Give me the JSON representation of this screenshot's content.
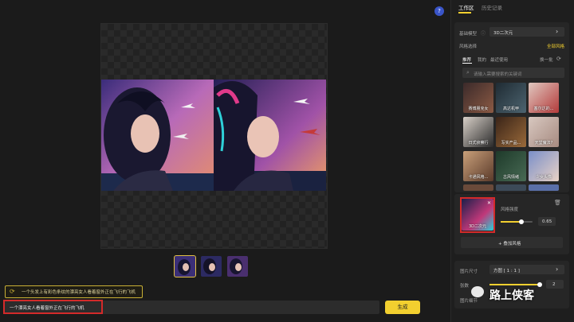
{
  "canvas": {
    "thumbnails": [
      {
        "label": "thumbnail-1",
        "selected": true
      },
      {
        "label": "thumbnail-2",
        "selected": false
      },
      {
        "label": "thumbnail-3",
        "selected": false
      }
    ]
  },
  "help_label": "?",
  "history_chip": "一个头发上有彩色条纹的漂亮女人看着窗外正在飞行的飞机",
  "prompt": {
    "value": "一个漂亮女人看着窗外正在飞行的飞机"
  },
  "generate_label": "生成",
  "panel": {
    "tabs": [
      "工作区",
      "历史记录"
    ],
    "base_model_label": "基础模型",
    "base_model_value": "3D二次元",
    "style_select_label": "风格选择",
    "all_styles": "全部风格",
    "style_tabs": [
      "推荐",
      "我的",
      "最近使用"
    ],
    "refresh_label": "换一批",
    "search_placeholder": "请输入需要搜索的关键词",
    "styles": [
      "赛博朋克女",
      "高达机甲",
      "塞尔达的...",
      "日式侦察行",
      "写实产品...",
      "天堂魔法?",
      "卡通风格...",
      "古风情绪",
      "少女头像",
      "",
      "",
      ""
    ],
    "selected_style": {
      "name": "3D二次元",
      "strength_label": "风格强度",
      "strength_value": "0.65",
      "strength": 0.65
    },
    "add_style_label": "+ 叠加风格",
    "size_label": "图片尺寸",
    "size_value": "方图 [ 1 : 1 ]",
    "count_label": "张数",
    "count_value": "2",
    "count_fraction": 0.95,
    "more_label": "图片细节"
  },
  "watermark": {
    "text": "路上侠客"
  },
  "colors": {
    "accent": "#f2cf2f",
    "highlight": "#d42a2a"
  }
}
